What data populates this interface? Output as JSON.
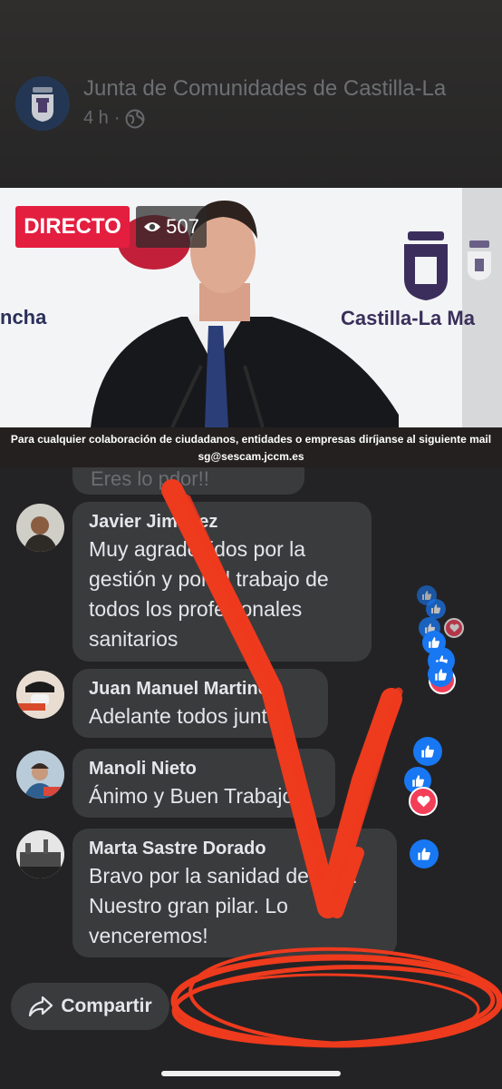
{
  "header": {
    "page_name": "Junta de Comunidades de Castilla-La",
    "time": "4 h",
    "separator": "·",
    "avatar_icon": "castilla-la-mancha-crest-icon",
    "audience_icon": "globe-icon"
  },
  "video": {
    "live_label": "DIRECTO",
    "viewer_count": "507",
    "viewer_icon": "eye-icon",
    "backdrop_left_text": "ncha",
    "backdrop_right_text": "Castilla-La Ma",
    "ticker_line1": "Para cualquier colaboración de ciudadanos, entidades o empresas diríjanse al siguiente mail",
    "ticker_line2": "sg@sescam.jccm.es"
  },
  "comments": {
    "previous_partial_text": "Eres lo pdor!!",
    "items": [
      {
        "name": "Javier Jiménez",
        "text": "Muy agradecidos por la gestión y por el trabajo de todos los profesionales sanitarios"
      },
      {
        "name": "Juan Manuel Martinez",
        "text": "Adelante todos juntos"
      },
      {
        "name": "Manoli Nieto",
        "text": "Ánimo y Buen Trabajo"
      },
      {
        "name": "Marta Sastre Dorado",
        "text": "Bravo por la sanidad de Clm! Nuestro gran pilar. Lo venceremos!"
      }
    ]
  },
  "actions": {
    "share_label": "Compartir",
    "share_icon": "share-arrow-icon"
  },
  "colors": {
    "live_red": "#e41e3f",
    "facebook_blue": "#1877f2",
    "love_red": "#f33e58",
    "annotation_red": "#ee3a1d",
    "bubble": "#3a3b3d",
    "background": "#232325"
  }
}
